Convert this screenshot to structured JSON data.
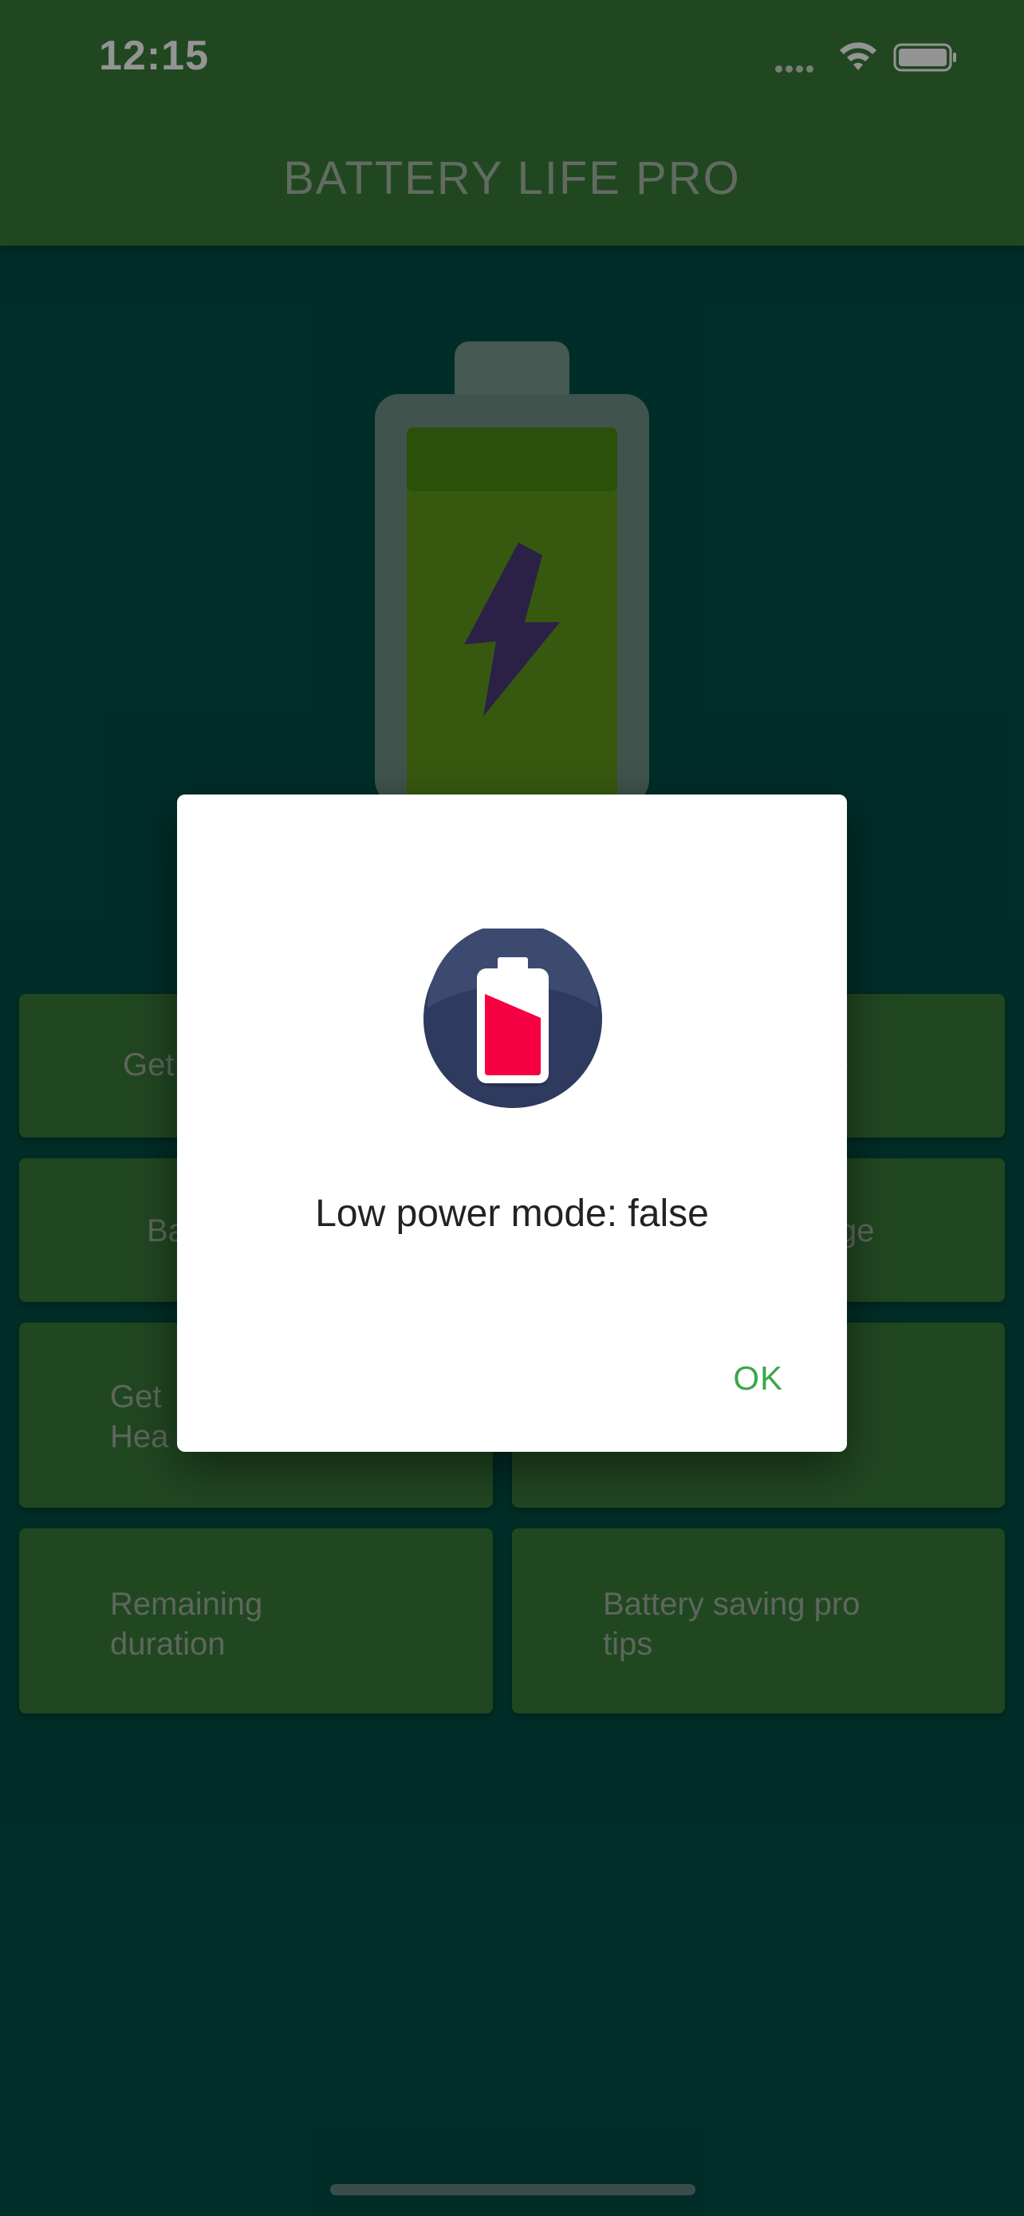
{
  "status_bar": {
    "time": "12:15"
  },
  "app_bar": {
    "title": "BATTERY LIFE PRO"
  },
  "colors": {
    "background": "#004F45",
    "app_bar": "#3A7A3A",
    "button": "#3A7A3A",
    "ok_accent": "#3AA84A",
    "battery_fill_red": "#F50040",
    "icon_circle": "#2E3A5E"
  },
  "grid": {
    "buttons": [
      {
        "label": "Get",
        "obscured": true
      },
      {
        "label": "e",
        "obscured": true
      },
      {
        "label": "Ba",
        "obscured": true
      },
      {
        "label": "ge",
        "obscured": true
      },
      {
        "label_line1": "Get",
        "label_line2": "Hea",
        "obscured": true
      },
      {
        "label": "",
        "obscured": true
      },
      {
        "label_line1": "Remaining",
        "label_line2": "duration"
      },
      {
        "label_line1": "Battery saving pro",
        "label_line2": "tips"
      }
    ]
  },
  "dialog": {
    "icon": "battery-low-icon",
    "message": "Low power mode: false",
    "ok_label": "OK"
  }
}
